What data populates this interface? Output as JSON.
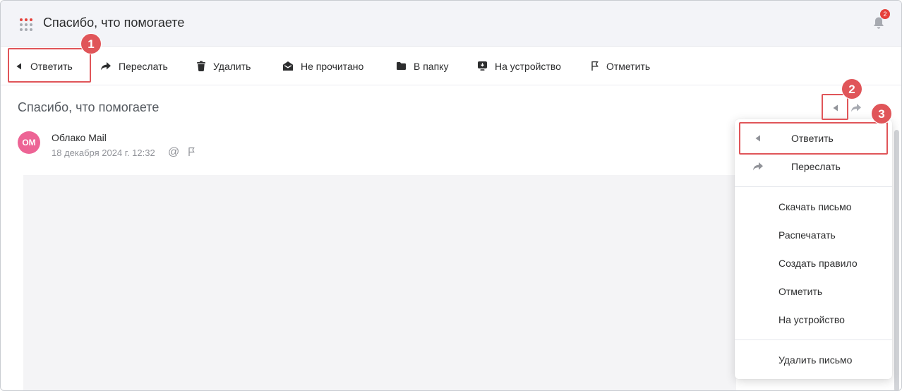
{
  "header": {
    "title": "Спасибо, что помогаете",
    "apps_icon": "apps-grid-icon",
    "notifications_count": "2"
  },
  "toolbar": {
    "reply": "Ответить",
    "forward": "Переслать",
    "delete": "Удалить",
    "unread": "Не прочитано",
    "to_folder": "В папку",
    "to_device": "На устройство",
    "mark": "Отметить"
  },
  "letter": {
    "subject": "Спасибо, что помогаете",
    "avatar_initials": "OM",
    "sender": "Облако Mail",
    "date": "18 декабря 2024 г. 12:32",
    "at_symbol": "@"
  },
  "menu": {
    "reply": "Ответить",
    "forward": "Переслать",
    "download": "Скачать письмо",
    "print": "Распечатать",
    "create_rule": "Создать правило",
    "mark": "Отметить",
    "to_device": "На устройство",
    "delete": "Удалить письмо"
  },
  "annotations": {
    "step1": "1",
    "step2": "2",
    "step3": "3"
  },
  "colors": {
    "highlight": "#e05559",
    "header_bg": "#f3f4f8",
    "avatar": "#ed6495",
    "badge": "#e5403a"
  }
}
